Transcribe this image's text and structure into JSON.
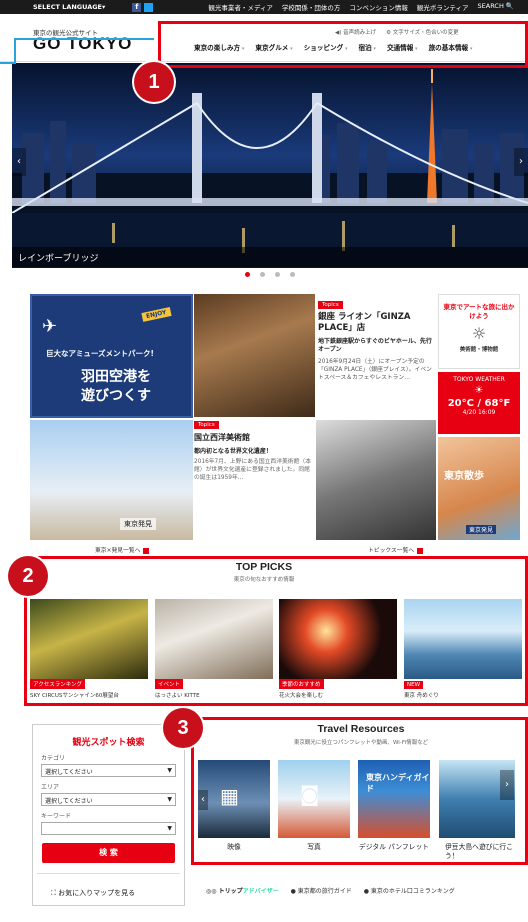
{
  "topbar": {
    "select_language": "SELECT LANGUAGE▾",
    "facebook_letter": "f",
    "links": [
      "観光事業者・メディア",
      "学校関係・団体の方",
      "コンベンション情報",
      "観光ボランティア",
      "SEARCH 🔍"
    ]
  },
  "header": {
    "logo_sub": "東京の観光公式サイト",
    "logo": "GO TOKYO",
    "util": [
      "◀) 音声読み上げ",
      "⚙ 文字サイズ・色合いの変更"
    ],
    "nav": [
      "東京の楽しみ方",
      "東京グルメ",
      "ショッピング",
      "宿泊",
      "交通情報",
      "旅の基本情報"
    ]
  },
  "callouts": {
    "one": "1",
    "two": "2",
    "three": "3"
  },
  "hero": {
    "caption": "レインボーブリッジ",
    "prev": "‹",
    "next": "›"
  },
  "feature": {
    "haneda_small": "巨大なアミューズメントパーク!",
    "haneda_big_1": "羽田空港を",
    "haneda_big_2": "遊びつくす",
    "haneda_badge": "ENJOY",
    "ginza_tag": "Topics",
    "ginza_title": "銀座 ライオン「GINZA PLACE」店",
    "ginza_sub": "地下鉄銀座駅からすぐのビヤホール、先行オープン",
    "ginza_body": "2016年9月24日（土）にオープン予定の「GINZA PLACE」（銀座プレイス）。イベントスペース＆カフェやレストラン…",
    "art_text": "東京でアートな旅に出かけよう",
    "art_label": "美術館・博物館",
    "weather_title": "TOKYO WEATHER",
    "weather_temp": "20°C / 68°F",
    "weather_date": "4/20 16:09",
    "kokuritsu_tag": "Topics",
    "kokuritsu_title": "国立西洋美術館",
    "kokuritsu_sub": "都内初となる世界文化遺産！",
    "kokuritsu_body": "2016年7月、上野にある国立西洋美術館（本館）が世界文化遺産に登録されました。同館の誕生は1959年…",
    "tokyo_map_label": "東京発見",
    "more_left": "東京×発見一覧へ",
    "more_right": "トピックス一覧へ"
  },
  "top_picks": {
    "title": "TOP PICKS",
    "sub": "東京の旬なおすすめ情報",
    "items": [
      {
        "label": "アクセスランキング",
        "caption": "SKY CIRCUSサンシャイン60展望台"
      },
      {
        "label": "イベント",
        "caption": "はっさよい KITTE"
      },
      {
        "label": "季節のおすすめ",
        "caption": "花火大会を楽しむ"
      },
      {
        "label": "NEW",
        "caption": "東京 舟めぐり"
      }
    ]
  },
  "search": {
    "title": "観光スポット検索",
    "category_label": "カテゴリ",
    "category_value": "選択してください",
    "area_label": "エリア",
    "area_value": "選択してください",
    "keyword_label": "キーワード",
    "button": "検 索",
    "favorites": "お気に入りマップを見る"
  },
  "travel": {
    "title": "Travel Resources",
    "sub": "東京観光に役立つパンフレットや動画、Wi-Fi情報など",
    "items": [
      "映像",
      "写真",
      "デジタル パンフレット",
      "伊豆大島へ遊びに行こう！"
    ],
    "guide_text": "東京ハンディガイド",
    "prev": "‹",
    "next": "›"
  },
  "tripadvisor": {
    "brand_1": "トリップ",
    "brand_2": "アドバイザー",
    "links": [
      "東京都の旅行ガイド",
      "東京のホテル口コミランキング"
    ]
  }
}
